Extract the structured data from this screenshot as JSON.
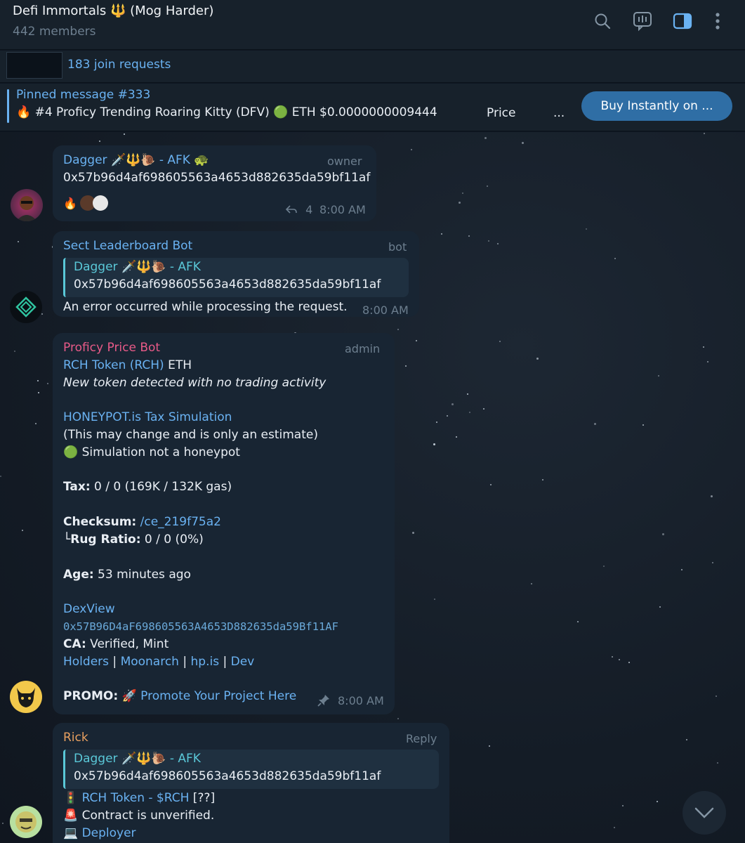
{
  "header": {
    "title": "Defi Immortals 🔱 (Mog Harder)",
    "members": "442 members",
    "icons": [
      "search-icon",
      "voice-chat-icon",
      "sidebar-toggle-icon",
      "more-icon"
    ]
  },
  "join_bar": {
    "label": "183 join requests"
  },
  "pinned": {
    "title": "Pinned message #333",
    "text": "🔥 #4 Proficy Trending Roaring Kitty (DFV) 🟢 ETH $0.0000000009444",
    "price_label": "Price",
    "ellipsis": "...",
    "button": "Buy Instantly on ..."
  },
  "messages": {
    "m1": {
      "sender": "Dagger 🗡️🔱🐌 - AFK 🐢",
      "role": "owner",
      "text": "0x57b96d4af698605563a4653d882635da59bf11af",
      "reactions": "🔥",
      "reply_count": "4",
      "time": "8:00 AM"
    },
    "m2": {
      "sender": "Sect Leaderboard Bot",
      "role": "bot",
      "quote_name": "Dagger 🗡️🔱🐌 - AFK",
      "quote_text": "0x57b96d4af698605563a4653d882635da59bf11af",
      "text": "An error occurred while processing the request.",
      "time": "8:00 AM"
    },
    "m3": {
      "sender": "Proficy Price Bot",
      "role": "admin",
      "token_link": "RCH Token (RCH)",
      "token_chain": " ETH",
      "detected": "New token detected with no trading activity",
      "honeypot_link": "HONEYPOT.is Tax Simulation",
      "estimate": "(This may change and is only an estimate)",
      "simulation": "🟢 Simulation not a honeypot",
      "tax_label": "Tax:",
      "tax_value": " 0 / 0 (169K / 132K gas)",
      "checksum_label": "Checksum:",
      "checksum_link": " /ce_219f75a2",
      "rug_label": "└Rug Ratio:",
      "rug_value": " 0 / 0 (0%)",
      "age_label": "Age:",
      "age_value": " 53 minutes ago",
      "dexview": "DexView",
      "address": "0x57B96D4aF698605563A4653D882635da59Bf11AF",
      "ca_label": "CA:",
      "ca_value": " Verified, Mint",
      "links": [
        "Holders",
        "Moonarch",
        "hp.is",
        "Dev"
      ],
      "sep": " | ",
      "promo_label": "PROMO:",
      "promo_link": "🚀 Promote Your Project Here",
      "time": "8:00 AM"
    },
    "m4": {
      "sender": "Rick",
      "role": "Reply",
      "quote_name": "Dagger 🗡️🔱🐌 - AFK",
      "quote_text": "0x57b96d4af698605563a4653d882635da59bf11af",
      "line1_icon": "🚦",
      "line1_link": "RCH Token - $RCH",
      "line1_rest": " [??]",
      "line2_icon": "🚨",
      "line2_text": "Contract is unverified.",
      "line3_icon": "💻",
      "line3_link": "Deployer"
    }
  },
  "colors": {
    "accent": "#6ab2f2",
    "proficy": "#e85a88",
    "rick": "#e8a060",
    "quote": "#5ac8d8",
    "bubble": "#182533",
    "header": "#17212b",
    "button": "#2f6ea5"
  }
}
